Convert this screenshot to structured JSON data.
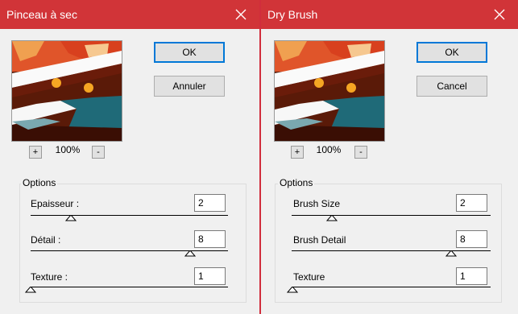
{
  "dialogs": [
    {
      "title": "Pinceau à sec",
      "ok_label": "OK",
      "cancel_label": "Annuler",
      "zoom_in": "+",
      "zoom_out": "-",
      "zoom_level": "100%",
      "options_label": "Options",
      "options": [
        {
          "label": "Epaisseur :",
          "value": "2",
          "level": 0.2
        },
        {
          "label": "Détail :",
          "value": "8",
          "level": 0.8
        },
        {
          "label": "Texture :",
          "value": "1",
          "level": 0.0
        }
      ]
    },
    {
      "title": "Dry Brush",
      "ok_label": "OK",
      "cancel_label": "Cancel",
      "zoom_in": "+",
      "zoom_out": "-",
      "zoom_level": "100%",
      "options_label": "Options",
      "options": [
        {
          "label": "Brush Size",
          "value": "2",
          "level": 0.2
        },
        {
          "label": "Brush Detail",
          "value": "8",
          "level": 0.8
        },
        {
          "label": "Texture",
          "value": "1",
          "level": 0.0
        }
      ]
    }
  ],
  "colors": {
    "titlebar": "#d13438",
    "default_button_border": "#0078d7"
  },
  "icons": {
    "close": "close-icon",
    "thumb": "slider-thumb-icon"
  }
}
